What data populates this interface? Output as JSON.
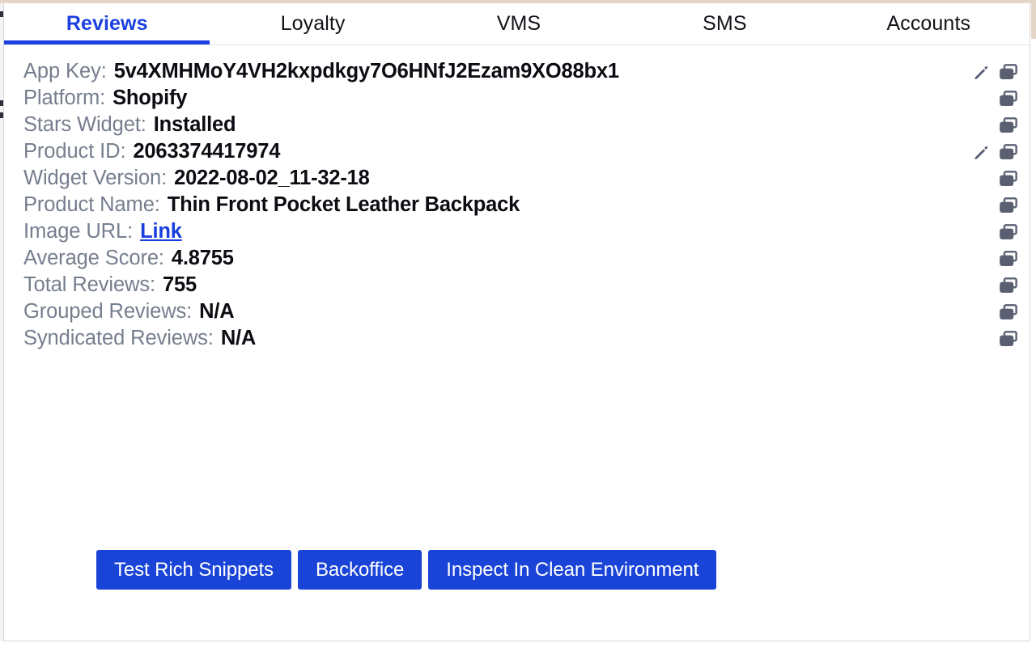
{
  "tabs": [
    {
      "label": "Reviews",
      "active": true
    },
    {
      "label": "Loyalty",
      "active": false
    },
    {
      "label": "VMS",
      "active": false
    },
    {
      "label": "SMS",
      "active": false
    },
    {
      "label": "Accounts",
      "active": false
    }
  ],
  "rows": [
    {
      "label": "App Key:",
      "value": "5v4XMHMoY4VH2kxpdkgy7O6HNfJ2Ezam9XO88bx1",
      "edit": true,
      "copy": true,
      "is_link": false
    },
    {
      "label": "Platform:",
      "value": "Shopify",
      "edit": false,
      "copy": true,
      "is_link": false
    },
    {
      "label": "Stars Widget:",
      "value": "Installed",
      "edit": false,
      "copy": true,
      "is_link": false
    },
    {
      "label": "Product ID:",
      "value": "2063374417974",
      "edit": true,
      "copy": true,
      "is_link": false
    },
    {
      "label": "Widget Version:",
      "value": "2022-08-02_11-32-18",
      "edit": false,
      "copy": true,
      "is_link": false
    },
    {
      "label": "Product Name:",
      "value": "Thin Front Pocket Leather Backpack",
      "edit": false,
      "copy": true,
      "is_link": false
    },
    {
      "label": "Image URL:",
      "value": "Link",
      "edit": false,
      "copy": true,
      "is_link": true
    },
    {
      "label": "Average Score:",
      "value": "4.8755",
      "edit": false,
      "copy": true,
      "is_link": false
    },
    {
      "label": "Total Reviews:",
      "value": "755",
      "edit": false,
      "copy": true,
      "is_link": false
    },
    {
      "label": "Grouped Reviews:",
      "value": "N/A",
      "edit": false,
      "copy": true,
      "is_link": false
    },
    {
      "label": "Syndicated Reviews:",
      "value": "N/A",
      "edit": false,
      "copy": true,
      "is_link": false
    }
  ],
  "buttons": [
    {
      "label": "Test Rich Snippets"
    },
    {
      "label": "Backoffice"
    },
    {
      "label": "Inspect In Clean Environment"
    }
  ],
  "icons": {
    "edit": "pencil-icon",
    "copy": "copy-icon"
  },
  "colors": {
    "accent": "#1c40e0",
    "button": "#1a44d8",
    "label": "#767e8e",
    "value": "#0b0d12",
    "icon": "#5a6072",
    "chrome": "#e4d5c9"
  }
}
